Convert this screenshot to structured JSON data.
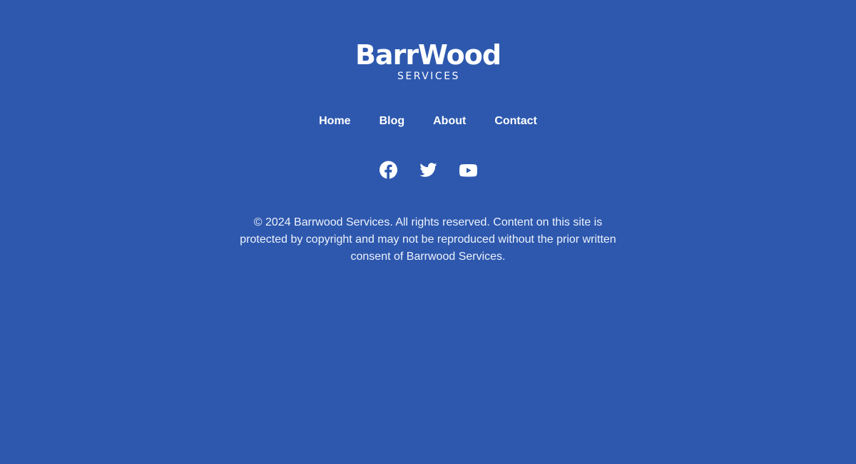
{
  "brand": {
    "name": "BarrWood",
    "tagline": "SERVICES"
  },
  "nav": {
    "items": [
      {
        "label": "Home"
      },
      {
        "label": "Blog"
      },
      {
        "label": "About"
      },
      {
        "label": "Contact"
      }
    ]
  },
  "social": {
    "icons": [
      "facebook-icon",
      "twitter-icon",
      "youtube-icon"
    ]
  },
  "footer": {
    "copyright": "© 2024 Barrwood Services. All rights reserved. Content on this site is protected by copyright and may not be reproduced without the prior written consent of Barrwood Services."
  },
  "colors": {
    "background": "#2d58ae",
    "text": "#ffffff"
  }
}
